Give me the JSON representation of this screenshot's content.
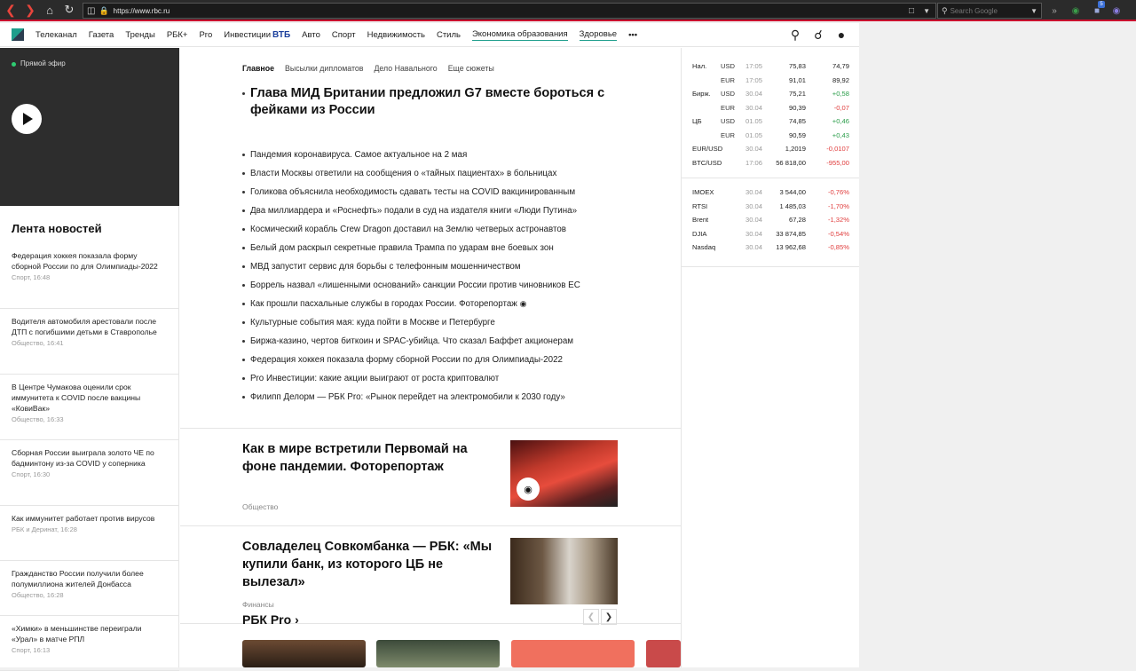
{
  "browser": {
    "url": "https://www.rbc.ru",
    "search_placeholder": "Search Google",
    "badge_count": "5"
  },
  "nav": {
    "items": [
      "Телеканал",
      "Газета",
      "Тренды",
      "РБК+",
      "Pro",
      "Инвестиции",
      "Авто",
      "Спорт",
      "Недвижимость",
      "Стиль",
      "Экономика образования",
      "Здоровье"
    ],
    "vtb": "ВТБ",
    "more": "•••"
  },
  "live": {
    "label": "Прямой эфир"
  },
  "feed": {
    "title": "Лента новостей",
    "items": [
      {
        "title": "Федерация хоккея показала форму сборной России по для Олимпиады-2022",
        "meta": "Спорт, 16:48"
      },
      {
        "title": "Водителя автомобиля арестовали после ДТП с погибшими детьми в Ставрополье",
        "meta": "Общество, 16:41"
      },
      {
        "title": "В Центре Чумакова оценили срок иммунитета к COVID после вакцины «КовиВак»",
        "meta": "Общество, 16:33"
      },
      {
        "title": "Сборная России выиграла золото ЧЕ по бадминтону из-за COVID у соперника",
        "meta": "Спорт, 16:30"
      },
      {
        "title": "Как иммунитет работает против вирусов",
        "meta": "РБК и Деринат, 16:28"
      },
      {
        "title": "Гражданство России получили более полумиллиона жителей Донбасса",
        "meta": "Общество, 16:28"
      },
      {
        "title": "«Химки» в меньшинстве переиграли «Урал» в матче РПЛ",
        "meta": "Спорт, 16:13"
      }
    ]
  },
  "center": {
    "tabs": [
      "Главное",
      "Высылки дипломатов",
      "Дело Навального",
      "Еще сюжеты"
    ],
    "main_headline": "Глава МИД Британии предложил G7 вместе бороться с фейками из России",
    "headlines": [
      "Пандемия коронавируса. Самое актуальное на 2 мая",
      "Власти Москвы ответили на сообщения о «тайных пациентах» в больницах",
      "Голикова объяснила необходимость сдавать тесты на COVID вакцинированным",
      "Два миллиардера и «Роснефть» подали в суд на издателя книги «Люди Путина»",
      "Космический корабль Crew Dragon доставил на Землю четверых астронавтов",
      "Белый дом раскрыл секретные правила Трампа по ударам вне боевых зон",
      "МВД запустит сервис для борьбы с телефонным мошенничеством",
      "Боррель назвал «лишенными оснований» санкции России против чиновников ЕС",
      "Как прошли пасхальные службы в городах России. Фоторепортаж",
      "Культурные события мая: куда пойти в Москве и Петербурге",
      "Биржа-казино, чертов биткоин и SPAC-убийца. Что сказал Баффет акционерам",
      "Федерация хоккея показала форму сборной России по для Олимпиады-2022",
      "Pro Инвестиции: какие акции выиграют от роста криптовалют",
      "Филипп Делорм — РБК Pro: «Рынок перейдет на электромобили к 2030 году»"
    ],
    "cards": [
      {
        "title": "Как в мире встретили Первомай на фоне пандемии. Фоторепортаж",
        "category": "Общество"
      },
      {
        "title": "Совладелец Совкомбанка — РБК: «Мы купили банк, из которого ЦБ не вылезал»",
        "category": "Финансы"
      }
    ],
    "pro_title": "РБК Pro ›"
  },
  "rates": {
    "rows": [
      {
        "label": "Нал.",
        "cur": "USD",
        "date": "17:05",
        "v1": "75,83",
        "v2": "74,79",
        "dir": ""
      },
      {
        "label": "",
        "cur": "EUR",
        "date": "17:05",
        "v1": "91,01",
        "v2": "89,92",
        "dir": ""
      },
      {
        "label": "Бирж.",
        "cur": "USD",
        "date": "30.04",
        "v1": "75,21",
        "v2": "+0,58",
        "dir": "pos"
      },
      {
        "label": "",
        "cur": "EUR",
        "date": "30.04",
        "v1": "90,39",
        "v2": "-0,07",
        "dir": "neg"
      },
      {
        "label": "ЦБ",
        "cur": "USD",
        "date": "01.05",
        "v1": "74,85",
        "v2": "+0,46",
        "dir": "pos"
      },
      {
        "label": "",
        "cur": "EUR",
        "date": "01.05",
        "v1": "90,59",
        "v2": "+0,43",
        "dir": "pos"
      },
      {
        "label": "EUR/USD",
        "cur": "",
        "date": "30.04",
        "v1": "1,2019",
        "v2": "-0,0107",
        "dir": "neg"
      },
      {
        "label": "BTC/USD",
        "cur": "",
        "date": "17:06",
        "v1": "56 818,00",
        "v2": "-955,00",
        "dir": "neg"
      }
    ],
    "indices": [
      {
        "label": "IMOEX",
        "date": "30.04",
        "v1": "3 544,00",
        "v2": "-0,76%",
        "dir": "neg"
      },
      {
        "label": "RTSI",
        "date": "30.04",
        "v1": "1 485,03",
        "v2": "-1,70%",
        "dir": "neg"
      },
      {
        "label": "Brent",
        "date": "30.04",
        "v1": "67,28",
        "v2": "-1,32%",
        "dir": "neg"
      },
      {
        "label": "DJIA",
        "date": "30.04",
        "v1": "33 874,85",
        "v2": "-0,54%",
        "dir": "neg"
      },
      {
        "label": "Nasdaq",
        "date": "30.04",
        "v1": "13 962,68",
        "v2": "-0,85%",
        "dir": "neg"
      }
    ]
  }
}
